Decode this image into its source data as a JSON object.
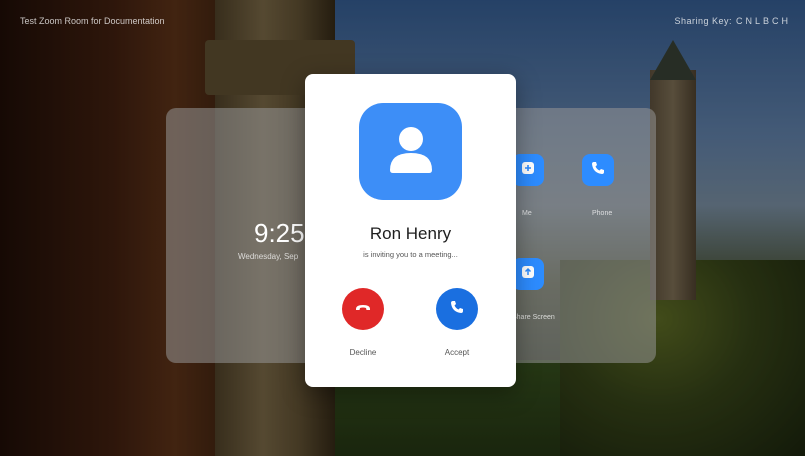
{
  "room": {
    "title": "Test Zoom Room for Documentation",
    "sharing_key_label": "Sharing Key:",
    "sharing_key_code": "CNLBCH"
  },
  "clock": {
    "time": "9:25",
    "date": "Wednesday, Sep"
  },
  "actions": {
    "tiles": [
      {
        "label": "Me",
        "icon": "plus-icon"
      },
      {
        "label": "Phone",
        "icon": "phone-icon"
      },
      {
        "label": "Share Screen",
        "icon": "share-screen-icon"
      }
    ]
  },
  "invite": {
    "caller_name": "Ron Henry",
    "message": "is inviting you to a meeting...",
    "decline_label": "Decline",
    "accept_label": "Accept",
    "avatar_icon": "person-icon"
  },
  "colors": {
    "accent": "#2d8cff",
    "decline": "#e02828",
    "accept": "#1a6fe0",
    "avatar": "#3d8ef7"
  }
}
